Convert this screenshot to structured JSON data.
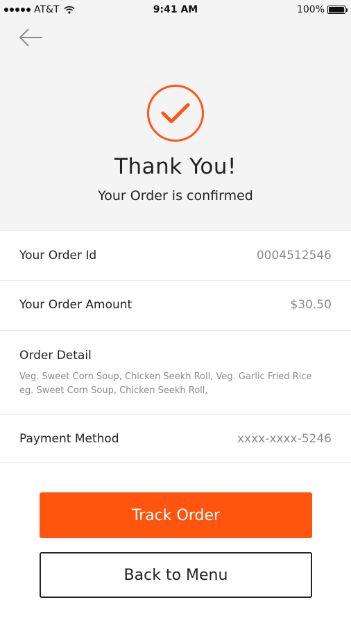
{
  "status_bar": {
    "carrier": "AT&T",
    "time": "9:41 AM",
    "battery": "100%"
  },
  "header": {
    "title": "Thank You!",
    "subtitle": "Your Order is confirmed",
    "accent_color": "#ff550f"
  },
  "order": {
    "id_label": "Your Order Id",
    "id_value": "0004512546",
    "amount_label": "Your Order Amount",
    "amount_value": "$30.50",
    "detail_label": "Order Detail",
    "detail_line_1": "Veg. Sweet Corn Soup, Chicken Seekh Roll, Veg. Garlic Fried Rice",
    "detail_line_2": "eg. Sweet Corn Soup, Chicken Seekh Roll,",
    "payment_label": "Payment Method",
    "payment_value": "xxxx-xxxx-5246"
  },
  "actions": {
    "track_label": "Track Order",
    "menu_label": "Back to Menu"
  },
  "icons": {
    "back": "back-arrow-icon",
    "confirm": "check-circle-icon",
    "wifi": "wifi-icon",
    "battery": "battery-icon",
    "signal": "signal-dots-icon"
  }
}
